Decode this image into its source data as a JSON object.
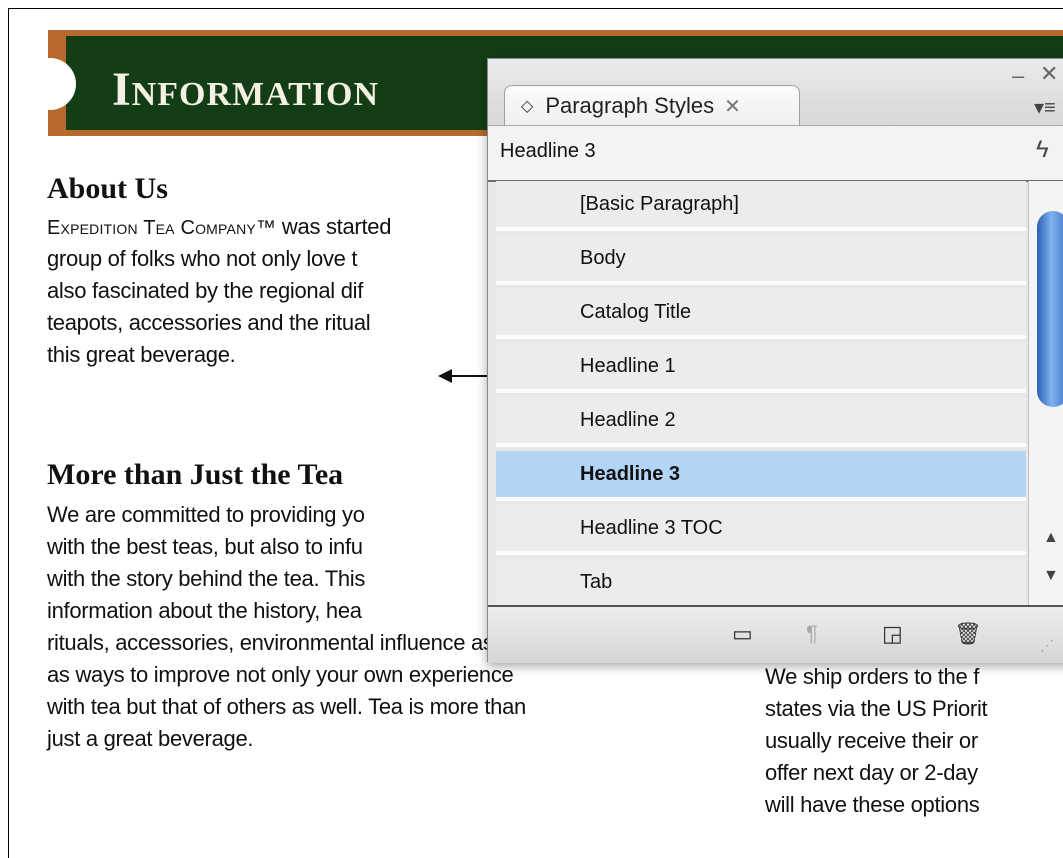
{
  "document": {
    "banner_title": "Information",
    "about": {
      "heading": "About Us",
      "brand": "Expedition Tea Company™",
      "lines": [
        " was started",
        "group of folks who not only love t",
        "also fascinated by the regional dif",
        "teapots, accessories and the ritual",
        "this great beverage."
      ]
    },
    "more": {
      "heading": "More than Just the Tea",
      "lines": [
        "We are committed to providing yo",
        "with the best teas, but also to infu",
        "with the story behind the tea. This",
        "information about the history, hea",
        "rituals, accessories, environmental influence as well",
        "as ways to improve not only your own experience",
        "with tea but that of others as well. Tea is more than",
        "just a great beverage."
      ]
    },
    "shipping": {
      "lines": [
        "We ship orders to the f",
        "states via the US Priorit",
        "usually receive their or",
        "offer next day or 2-day",
        "will have these options"
      ]
    }
  },
  "panel": {
    "tab_label": "Paragraph Styles",
    "current_style": "Headline 3",
    "styles": [
      "[Basic Paragraph]",
      "Body",
      "Catalog Title",
      "Headline 1",
      "Headline 2",
      "Headline 3",
      "Headline 3 TOC",
      "Tab"
    ],
    "selected_index": 5
  },
  "colors": {
    "banner_green": "#123d16",
    "banner_brown": "#b86a2e",
    "selection_blue": "#b2d4f5"
  }
}
